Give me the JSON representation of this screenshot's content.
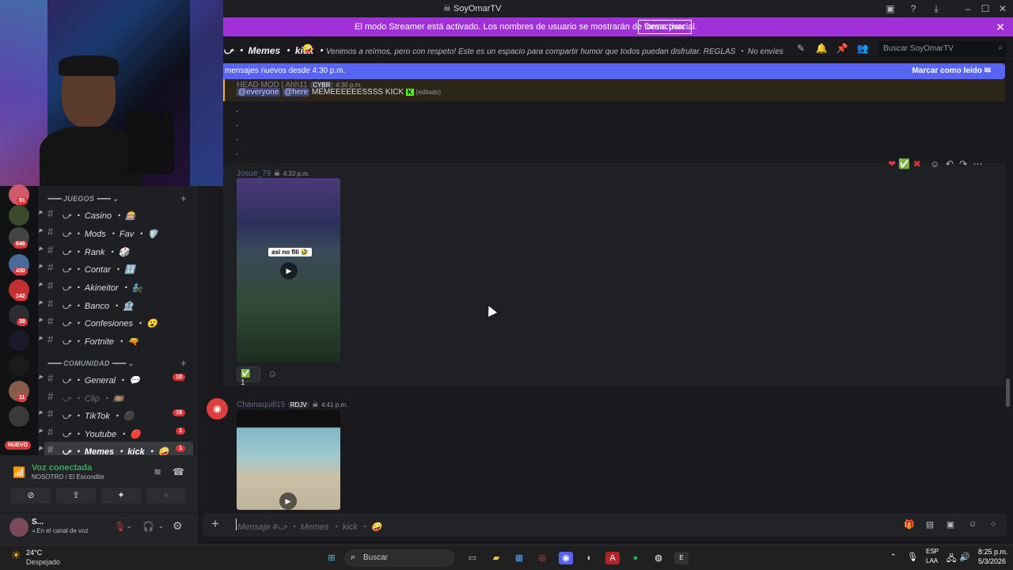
{
  "window": {
    "title": "SoyOmarTV"
  },
  "banner": {
    "message": "El modo Streamer está activado. Los nombres de usuario se mostrarán de forma parcial.",
    "button": "Desactivar"
  },
  "channel_header": {
    "name": "⤻ ・ Memes ・ kick ・",
    "topic": "Venimos a reírnos, pero con respeto! Este es un espacio para compartir humor que todos puedan disfrutar. REGLAS ・ No envíes memes que c...",
    "search_placeholder": "Buscar SoyOmarTV"
  },
  "new_messages": {
    "label": "mensajes nuevos desde 4:30 p.m.",
    "mark_read": "Marcar como leído"
  },
  "messages": [
    {
      "author": "HEAD MOD | Ahh11",
      "tag": "CYBR",
      "time": "4:30 p.m.",
      "mentions": [
        "@everyone",
        "@here"
      ],
      "text": "MEMEEEEEESSSS KICK",
      "edited": "(editado)",
      "dots": [
        ".",
        ".",
        ".",
        "."
      ]
    },
    {
      "author": "Josue_79",
      "time": "4:33 p.m.",
      "video_caption": "asi no flli 🤣",
      "reaction_count": "1"
    },
    {
      "author": "Chamaquill15",
      "tag": "RDJV",
      "time": "4:41 p.m."
    }
  ],
  "sidebar": {
    "servers": [
      {
        "badge": "91"
      },
      {
        "badge": ""
      },
      {
        "badge": "646"
      },
      {
        "badge": "430"
      },
      {
        "badge": "142"
      },
      {
        "badge": "38"
      },
      {
        "badge": ""
      },
      {
        "badge": ""
      },
      {
        "badge": "11"
      },
      {
        "badge": ""
      }
    ],
    "new_label": "NUEVO",
    "categories": [
      {
        "name": "JUEGOS"
      },
      {
        "name": "COMUNIDAD"
      }
    ],
    "channels": [
      {
        "name": "⤻ ・ Casino ・ 🎰",
        "badge": ""
      },
      {
        "name": "⤻ ・ Mods ・ Fav ・ 🛡️",
        "badge": ""
      },
      {
        "name": "⤻ ・ Rank ・ 🎲",
        "badge": ""
      },
      {
        "name": "⤻ ・ Contar ・ 🔢",
        "badge": ""
      },
      {
        "name": "⤻ ・ Akineitor ・ 🧞",
        "badge": ""
      },
      {
        "name": "⤻ ・ Banco ・ 🏦",
        "badge": ""
      },
      {
        "name": "⤻ ・ Confesiones ・ 😮",
        "badge": ""
      },
      {
        "name": "⤻ ・ Fortnite ・ 🔫",
        "badge": ""
      },
      {
        "name": "⤻ ・ General ・ 💬",
        "badge": "10"
      },
      {
        "name": "⤻ ・ Clip ・ 🎞️",
        "badge": ""
      },
      {
        "name": "⤻ ・ TikTok ・ ⚫",
        "badge": "16"
      },
      {
        "name": "⤻ ・ Youtube ・ 🔴",
        "badge": "1"
      },
      {
        "name": "⤻ ・ Memes ・ kick ・ 🤪",
        "badge": "1"
      }
    ]
  },
  "voice": {
    "status": "Voz conectada",
    "location": "NOSOTRO / El Escondite"
  },
  "user": {
    "name": "S...",
    "status": "En el canal de voz"
  },
  "composer": {
    "placeholder": "Mensaje #⤻ ・ Memes ・ kick ・ 🤪"
  },
  "taskbar": {
    "weather_temp": "24°C",
    "weather_desc": "Despejado",
    "search": "Buscar",
    "lang_top": "ESP",
    "lang_bottom": "LAA",
    "time": "8:25 p.m.",
    "date": "5/3/2026"
  },
  "colors": {
    "banner": "#a030d8",
    "new_bar": "#5865f2",
    "badge": "#da373c",
    "online": "#3ba55c"
  }
}
